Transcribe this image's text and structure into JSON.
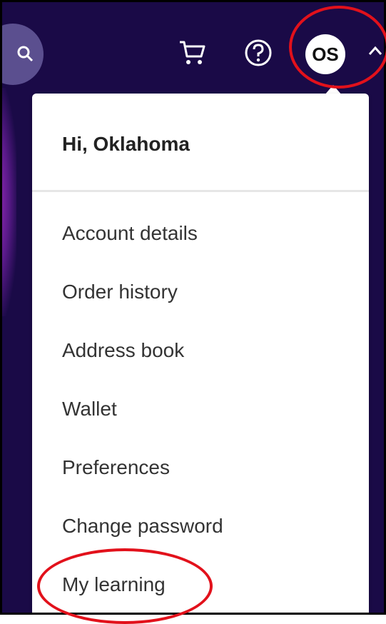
{
  "header": {
    "icons": {
      "search": "search-icon",
      "cart": "cart-icon",
      "help": "help-icon",
      "chevron": "chevron-up-icon"
    },
    "avatar_initials": "OS"
  },
  "menu": {
    "greeting": "Hi, Oklahoma",
    "items": [
      {
        "label": "Account details"
      },
      {
        "label": "Order history"
      },
      {
        "label": "Address book"
      },
      {
        "label": "Wallet"
      },
      {
        "label": "Preferences"
      },
      {
        "label": "Change password"
      },
      {
        "label": "My learning"
      }
    ]
  },
  "colors": {
    "header_bg": "#1a0a47",
    "annotation": "#e2111b"
  }
}
